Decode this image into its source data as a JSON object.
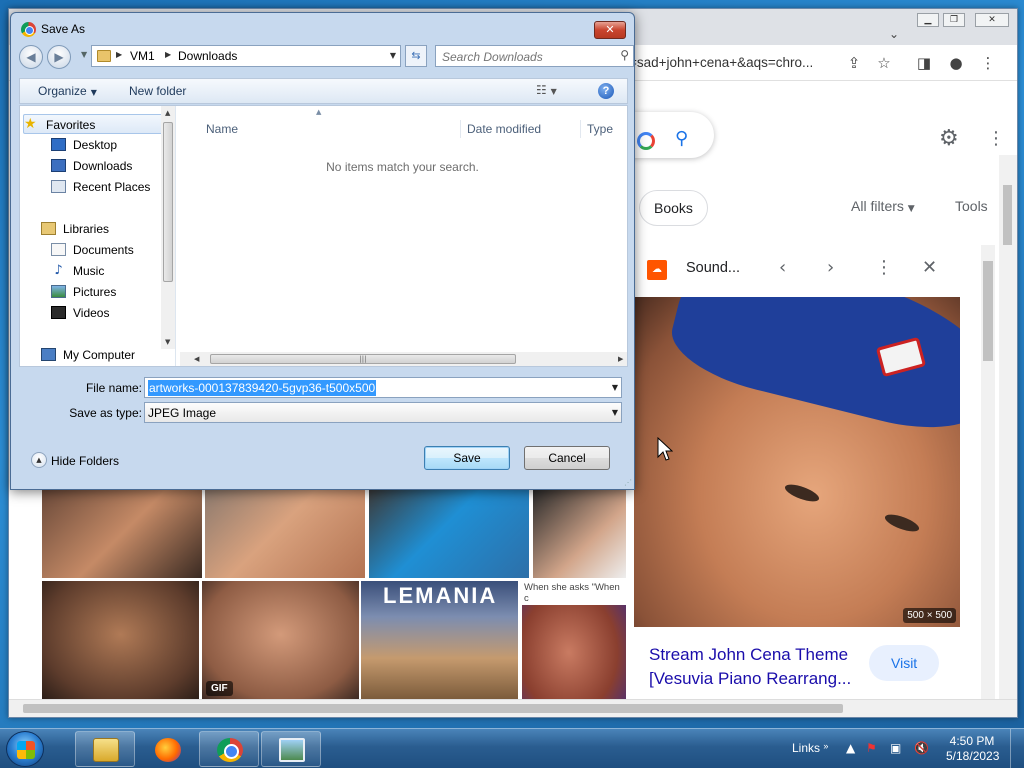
{
  "dialog": {
    "title": "Save As",
    "close_glyph": "✕",
    "breadcrumb": [
      "VM1",
      "Downloads"
    ],
    "search_placeholder": "Search Downloads",
    "commands": {
      "organize": "Organize",
      "new_folder": "New folder"
    },
    "nav": {
      "favorites": "Favorites",
      "favorites_items": [
        "Desktop",
        "Downloads",
        "Recent Places"
      ],
      "libraries": "Libraries",
      "libraries_items": [
        "Documents",
        "Music",
        "Pictures",
        "Videos"
      ],
      "computer": "My Computer"
    },
    "columns": {
      "name": "Name",
      "date_modified": "Date modified",
      "type": "Type"
    },
    "empty_message": "No items match your search.",
    "file_name_label": "File name:",
    "file_name_value": "artworks-000137839420-5gvp36-t500x500",
    "save_as_type_label": "Save as type:",
    "save_as_type_value": "JPEG Image",
    "hide_folders": "Hide Folders",
    "save_button": "Save",
    "cancel_button": "Cancel"
  },
  "browser": {
    "omnibox_text": "=sad+john+cena+&aqs=chro...",
    "chip_books": "Books",
    "all_filters": "All filters",
    "tools": "Tools",
    "side_panel": {
      "source": "Sound...",
      "image_dims": "500 × 500",
      "result_title": "Stream John Cena Theme [Vesuvia Piano Rearrang...",
      "visit": "Visit"
    },
    "thumb_labels": {
      "gif": "GIF",
      "caption": "When she asks \"When c",
      "watermark": "LEMANIA"
    }
  },
  "taskbar": {
    "links": "Links",
    "time": "4:50 PM",
    "date": "5/18/2023"
  },
  "colors": {
    "selection": "#3399ff",
    "accent": "#1a73e8",
    "dialog_frame": "#c7d9ee"
  }
}
